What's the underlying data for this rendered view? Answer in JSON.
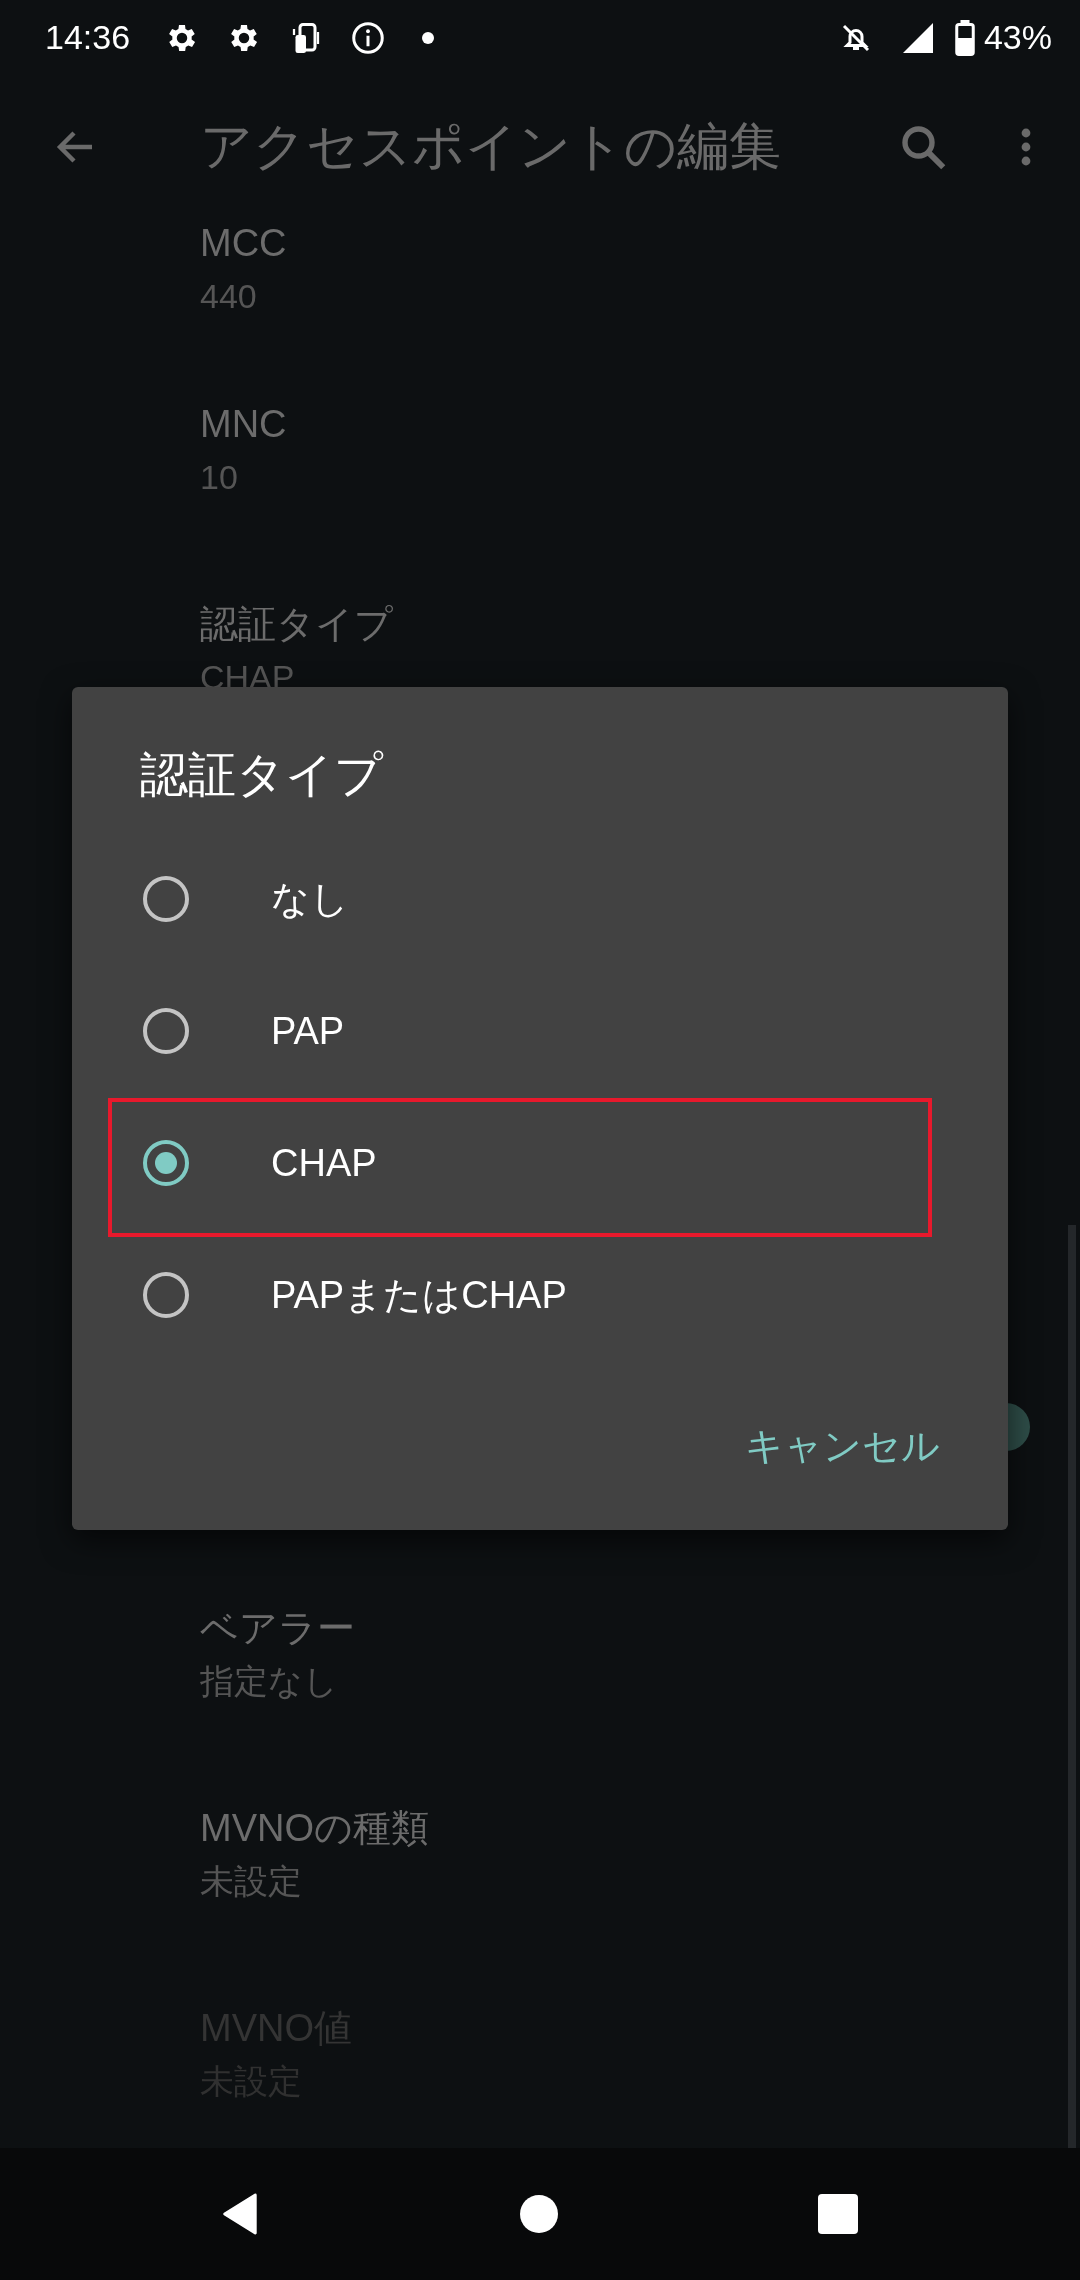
{
  "status_bar": {
    "time": "14:36",
    "battery": "43%"
  },
  "app_bar": {
    "title": "アクセスポイントの編集"
  },
  "settings": [
    {
      "kind": "text",
      "label": "MCC",
      "value": "440",
      "disabled": false
    },
    {
      "kind": "text",
      "label": "MNC",
      "value": "10",
      "disabled": false
    },
    {
      "kind": "text",
      "label": "認証タイプ",
      "value": "CHAP",
      "disabled": false
    },
    {
      "kind": "switch",
      "on": true
    },
    {
      "kind": "text",
      "label": "ベアラー",
      "value": "指定なし",
      "disabled": false
    },
    {
      "kind": "text",
      "label": "MVNOの種類",
      "value": "未設定",
      "disabled": false
    },
    {
      "kind": "text",
      "label": "MVNO値",
      "value": "未設定",
      "disabled": true
    }
  ],
  "dialog": {
    "title": "認証タイプ",
    "options": [
      {
        "label": "なし",
        "selected": false,
        "highlighted": false
      },
      {
        "label": "PAP",
        "selected": false,
        "highlighted": false
      },
      {
        "label": "CHAP",
        "selected": true,
        "highlighted": true
      },
      {
        "label": "PAPまたはCHAP",
        "selected": false,
        "highlighted": false
      }
    ],
    "cancel": "キャンセル"
  }
}
